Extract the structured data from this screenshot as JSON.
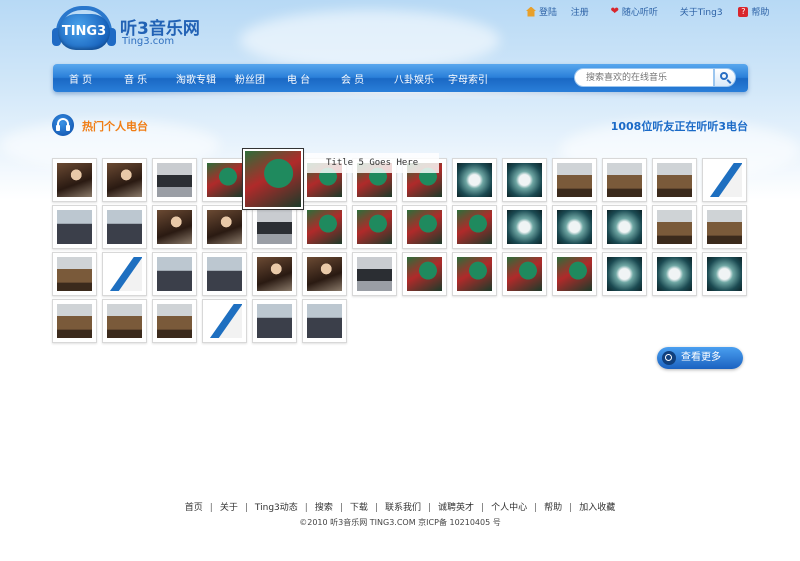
{
  "header": {
    "logo_badge": "TING3",
    "site_name": "听3音乐网",
    "site_url": "Ting3.com",
    "top_links": {
      "login": "登陆",
      "register": "注册",
      "random_listen": "随心听听",
      "about": "关于Ting3",
      "help": "帮助"
    }
  },
  "nav": {
    "items": [
      "首  页",
      "音  乐",
      "淘歌专辑",
      "粉丝团",
      "电  台",
      "会  员",
      "八卦娱乐",
      "字母索引"
    ],
    "search_placeholder": "搜索喜欢的在线音乐"
  },
  "section": {
    "title": "热门个人电台",
    "listener_count": "1008位听友正在听听3电台"
  },
  "tooltip": "Title 5 Goes Here",
  "photo_types": [
    "people",
    "biz",
    "car",
    "bird",
    "flower",
    "house",
    "brochure"
  ],
  "thumbnails": [
    "people",
    "people",
    "car",
    "bird",
    "bird",
    "bird",
    "bird",
    "bird",
    "flower",
    "flower",
    "house",
    "house",
    "house",
    "brochure",
    "biz",
    "biz",
    "people",
    "people",
    "car",
    "bird",
    "bird",
    "bird",
    "bird",
    "flower",
    "flower",
    "flower",
    "house",
    "house",
    "house",
    "brochure",
    "biz",
    "biz",
    "people",
    "people",
    "car",
    "bird",
    "bird",
    "bird",
    "bird",
    "flower",
    "flower",
    "flower",
    "house",
    "house",
    "house",
    "brochure",
    "biz",
    "biz"
  ],
  "more_button": "查看更多",
  "footer": {
    "links": [
      "首页",
      "关于",
      "Ting3动态",
      "搜索",
      "下载",
      "联系我们",
      "诚聘英才",
      "个人中心",
      "帮助",
      "加入收藏"
    ],
    "copyright": "©2010 听3音乐网 TING3.COM 京ICP备 10210405 号"
  }
}
